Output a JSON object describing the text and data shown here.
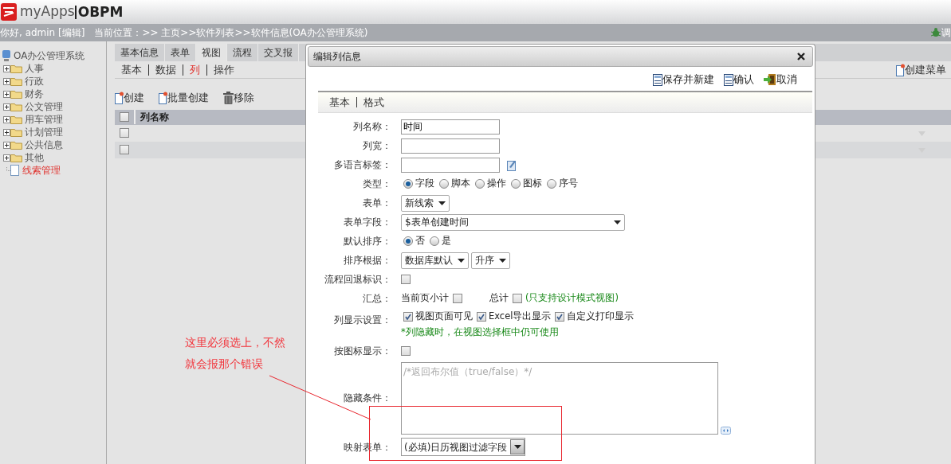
{
  "header": {
    "brand": "myApps",
    "product": "OBPM"
  },
  "infobar": {
    "greeting": "你好, admin [编辑]",
    "breadcrumb": "当前位置：>> 主页>>软件列表>>软件信息(OA办公管理系统)",
    "debug": "调"
  },
  "sidebar": {
    "tree": [
      {
        "label": "OA办公管理系统",
        "kind": "root",
        "children": [
          {
            "label": "人事",
            "kind": "folder",
            "expanded": false,
            "selected": false
          },
          {
            "label": "行政",
            "kind": "folder",
            "expanded": false,
            "selected": false
          },
          {
            "label": "财务",
            "kind": "folder",
            "expanded": false,
            "selected": false
          },
          {
            "label": "公文管理",
            "kind": "folder",
            "expanded": false,
            "selected": false
          },
          {
            "label": "用车管理",
            "kind": "folder",
            "expanded": false,
            "selected": false
          },
          {
            "label": "计划管理",
            "kind": "folder",
            "expanded": false,
            "selected": false
          },
          {
            "label": "公共信息",
            "kind": "folder",
            "expanded": false,
            "selected": false
          },
          {
            "label": "其他",
            "kind": "folder",
            "expanded": false,
            "selected": false
          },
          {
            "label": "线索管理",
            "kind": "page",
            "selected": true
          }
        ]
      }
    ]
  },
  "tabs": [
    {
      "label": "基本信息",
      "selected": false
    },
    {
      "label": "表单",
      "selected": false
    },
    {
      "label": "视图",
      "selected": true
    },
    {
      "label": "流程",
      "selected": false
    },
    {
      "label": "交叉报",
      "selected": false
    }
  ],
  "subtabs": [
    {
      "label": "基本",
      "selected": false
    },
    {
      "label": "数据",
      "selected": false
    },
    {
      "label": "列",
      "selected": true
    },
    {
      "label": "操作",
      "selected": false
    }
  ],
  "toolbar": [
    {
      "label": "创建",
      "kind": "new"
    },
    {
      "label": "批量创建",
      "kind": "new"
    },
    {
      "label": "移除",
      "kind": "delete"
    }
  ],
  "menu_button": "创建菜单",
  "table": {
    "select_all": {
      "checked": false
    },
    "columns": [
      "列名称"
    ],
    "rows": [
      {
        "checked": false
      },
      {
        "checked": false
      }
    ]
  },
  "dialog": {
    "title": "编辑列信息",
    "buttons": [
      {
        "label": "保存并新建",
        "kind": "save"
      },
      {
        "label": "确认",
        "kind": "save"
      },
      {
        "label": "取消",
        "kind": "exit"
      }
    ],
    "tabs": [
      "基本",
      "格式"
    ],
    "fields": [
      {
        "kind": "text",
        "label": "列名称：",
        "value": "时间"
      },
      {
        "kind": "text",
        "label": "列宽："
      },
      {
        "kind": "langtext",
        "label": "多语言标签："
      },
      {
        "kind": "radio",
        "label": "类型：",
        "options": [
          {
            "label": "字段",
            "selected": true
          },
          {
            "label": "脚本",
            "selected": false
          },
          {
            "label": "操作",
            "selected": false
          },
          {
            "label": "图标",
            "selected": false
          },
          {
            "label": "序号",
            "selected": false
          }
        ]
      },
      {
        "kind": "select",
        "label": "表单：",
        "selects": [
          "新线索"
        ]
      },
      {
        "kind": "wideselect",
        "label": "表单字段：",
        "selects": [
          "$表单创建时间"
        ]
      },
      {
        "kind": "radio",
        "label": "默认排序：",
        "options": [
          {
            "label": "否",
            "selected": true
          },
          {
            "label": "是",
            "selected": false
          }
        ]
      },
      {
        "kind": "select",
        "label": "排序根据：",
        "selects": [
          "数据库默认",
          "升序"
        ]
      },
      {
        "kind": "checkbox",
        "label": "流程回退标识：",
        "checked": false
      },
      {
        "kind": "checks",
        "label": "汇总：",
        "items": [
          {
            "label": "当前页小计",
            "checked": false
          },
          {
            "label": "总计",
            "checked": false
          }
        ],
        "note": "(只支持设计模式视图)"
      },
      {
        "kind": "checks",
        "label": "列显示设置：",
        "items": [
          {
            "label": "视图页面可见",
            "checked": true
          },
          {
            "label": "Excel导出显示",
            "checked": true
          },
          {
            "label": "自定义打印显示",
            "checked": true
          }
        ],
        "note": "*列隐藏时，在视图选择框中仍可使用"
      },
      {
        "kind": "checkbox",
        "label": "按图标显示：",
        "checked": false
      },
      {
        "kind": "textarea",
        "label": "隐藏条件：",
        "placeholder": "/*返回布尔值（true/false）*/"
      },
      {
        "kind": "dropdown",
        "label": "映射表单：",
        "value": "(必填)日历视图过滤字段"
      }
    ]
  },
  "annotation": {
    "lines": [
      "这里必须选上，不然",
      "就会报那个错误"
    ]
  }
}
